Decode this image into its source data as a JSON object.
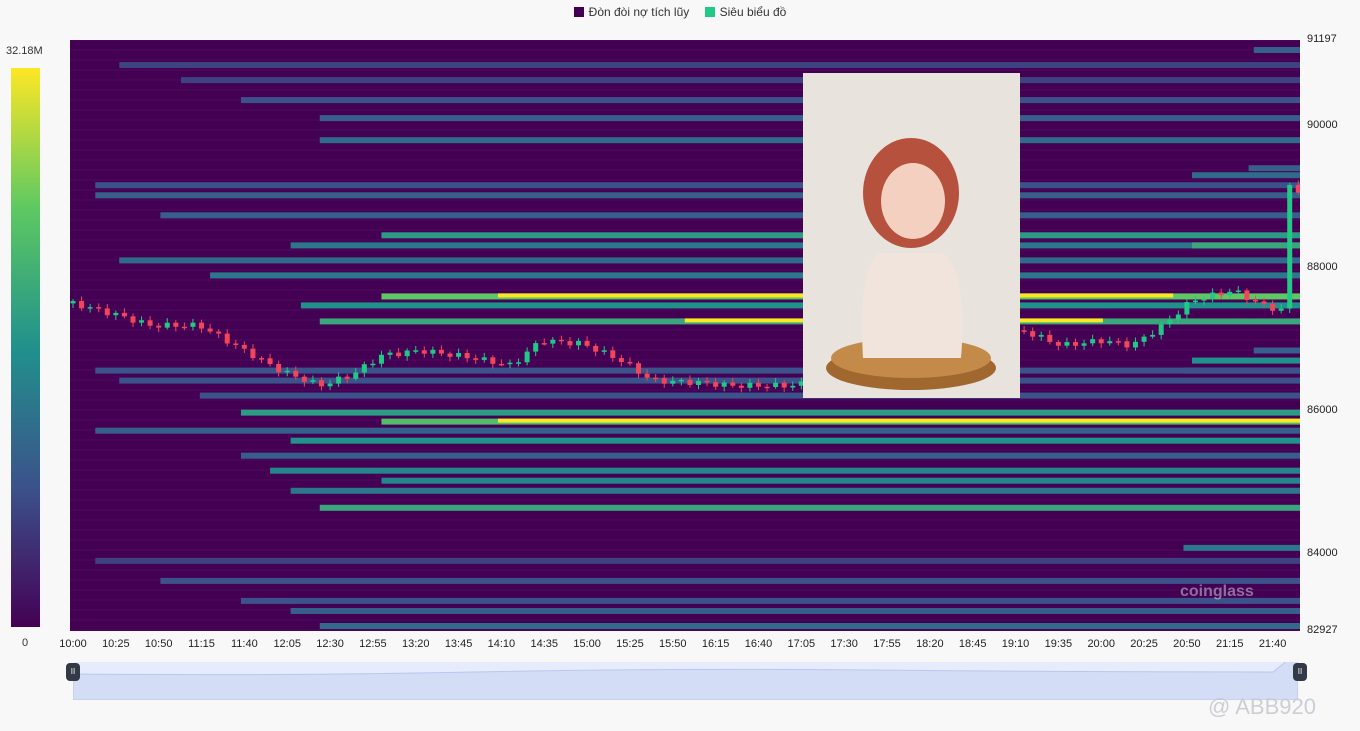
{
  "chart_data": {
    "type": "heatmap",
    "title": "",
    "legend": [
      {
        "label": "Đòn đòi nợ tích lũy",
        "color": "#440154"
      },
      {
        "label": "Siêu biểu đồ",
        "color": "#22c886"
      }
    ],
    "legend_position": "top-center",
    "colorbar": {
      "max_label": "32.18M",
      "min_label": "0",
      "max": 32.18,
      "min": 0
    },
    "ylim": [
      82927,
      91197
    ],
    "y_ticks": [
      "91197",
      "90000",
      "88000",
      "86000",
      "84000",
      "82927"
    ],
    "y_tick_values": [
      91197,
      90000,
      88000,
      86000,
      84000,
      82927
    ],
    "x_range": [
      "10:00",
      "21:56"
    ],
    "x_ticks": [
      "10:00",
      "10:25",
      "10:50",
      "11:15",
      "11:40",
      "12:05",
      "12:30",
      "12:55",
      "13:20",
      "13:45",
      "14:10",
      "14:35",
      "15:00",
      "15:25",
      "15:50",
      "16:15",
      "16:40",
      "17:05",
      "17:30",
      "17:55",
      "18:20",
      "18:45",
      "19:10",
      "19:35",
      "20:00",
      "20:25",
      "20:50",
      "21:15",
      "21:40"
    ],
    "bands": [
      {
        "price": 91057,
        "start": "21:29",
        "intensity": 0.3
      },
      {
        "price": 90847,
        "start": "10:27",
        "intensity": 0.2
      },
      {
        "price": 90636,
        "start": "11:03",
        "intensity": 0.2
      },
      {
        "price": 90356,
        "start": "11:38",
        "intensity": 0.25
      },
      {
        "price": 90104,
        "start": "12:24",
        "intensity": 0.3
      },
      {
        "price": 89795,
        "start": "12:24",
        "intensity": 0.35
      },
      {
        "price": 89403,
        "start": "21:26",
        "intensity": 0.3
      },
      {
        "price": 89305,
        "start": "20:53",
        "intensity": 0.35
      },
      {
        "price": 89165,
        "start": "10:13",
        "intensity": 0.25
      },
      {
        "price": 89024,
        "start": "10:13",
        "intensity": 0.3
      },
      {
        "price": 88744,
        "start": "10:51",
        "intensity": 0.3
      },
      {
        "price": 88464,
        "start": "13:00",
        "intensity": 0.55
      },
      {
        "price": 88323,
        "start": "12:07",
        "intensity": 0.4
      },
      {
        "price": 88323,
        "start": "20:53",
        "intensity": 0.6
      },
      {
        "price": 88113,
        "start": "10:27",
        "intensity": 0.35
      },
      {
        "price": 87903,
        "start": "11:20",
        "intensity": 0.4
      },
      {
        "price": 87609,
        "start": "13:00",
        "intensity": 0.75
      },
      {
        "price": 87609,
        "start": "14:08",
        "end": "20:42",
        "intensity": 1
      },
      {
        "price": 87483,
        "start": "12:13",
        "intensity": 0.5
      },
      {
        "price": 87259,
        "start": "12:24",
        "intensity": 0.6
      },
      {
        "price": 87259,
        "start": "15:57",
        "end": "20:01",
        "intensity": 1
      },
      {
        "price": 86852,
        "start": "21:29",
        "intensity": 0.3
      },
      {
        "price": 86711,
        "start": "20:53",
        "intensity": 0.5
      },
      {
        "price": 86571,
        "start": "20:48",
        "intensity": 0.5
      },
      {
        "price": 86571,
        "start": "10:13",
        "intensity": 0.25
      },
      {
        "price": 86431,
        "start": "10:27",
        "intensity": 0.25
      },
      {
        "price": 86221,
        "start": "11:14",
        "intensity": 0.25
      },
      {
        "price": 85983,
        "start": "11:38",
        "intensity": 0.55
      },
      {
        "price": 85857,
        "start": "13:00",
        "intensity": 0.7
      },
      {
        "price": 85857,
        "start": "14:08",
        "intensity": 1
      },
      {
        "price": 85730,
        "start": "10:13",
        "intensity": 0.3
      },
      {
        "price": 85590,
        "start": "12:07",
        "intensity": 0.5
      },
      {
        "price": 85380,
        "start": "11:38",
        "intensity": 0.3
      },
      {
        "price": 85170,
        "start": "11:55",
        "intensity": 0.45
      },
      {
        "price": 85030,
        "start": "13:00",
        "intensity": 0.45
      },
      {
        "price": 84889,
        "start": "12:07",
        "intensity": 0.4
      },
      {
        "price": 84651,
        "start": "12:24",
        "intensity": 0.6
      },
      {
        "price": 84090,
        "start": "20:48",
        "intensity": 0.4
      },
      {
        "price": 83908,
        "start": "10:13",
        "intensity": 0.2
      },
      {
        "price": 83628,
        "start": "10:51",
        "intensity": 0.25
      },
      {
        "price": 83348,
        "start": "11:38",
        "intensity": 0.25
      },
      {
        "price": 83207,
        "start": "12:07",
        "intensity": 0.3
      },
      {
        "price": 82997,
        "start": "12:24",
        "intensity": 0.35
      }
    ],
    "price_path": [
      [
        "10:00",
        87511
      ],
      [
        "10:27",
        87342
      ],
      [
        "10:45",
        87202
      ],
      [
        "11:14",
        87202
      ],
      [
        "11:38",
        86880
      ],
      [
        "12:01",
        86571
      ],
      [
        "12:24",
        86361
      ],
      [
        "12:42",
        86501
      ],
      [
        "13:00",
        86782
      ],
      [
        "13:23",
        86852
      ],
      [
        "13:52",
        86754
      ],
      [
        "14:16",
        86642
      ],
      [
        "14:33",
        86992
      ],
      [
        "14:57",
        86950
      ],
      [
        "15:20",
        86711
      ],
      [
        "15:38",
        86431
      ],
      [
        "16:07",
        86403
      ],
      [
        "16:24",
        86361
      ],
      [
        "16:59",
        86361
      ],
      [
        "17:35",
        86500
      ],
      [
        "18:30",
        86800
      ],
      [
        "19:14",
        87132
      ],
      [
        "19:37",
        86922
      ],
      [
        "20:01",
        86992
      ],
      [
        "20:18",
        86922
      ],
      [
        "20:36",
        87202
      ],
      [
        "20:53",
        87553
      ],
      [
        "21:17",
        87693
      ],
      [
        "21:34",
        87483
      ],
      [
        "21:46",
        87413
      ],
      [
        "21:49",
        89165
      ],
      [
        "21:55",
        89100
      ]
    ]
  },
  "watermark": "coinglass",
  "credit": "@ ABB920"
}
